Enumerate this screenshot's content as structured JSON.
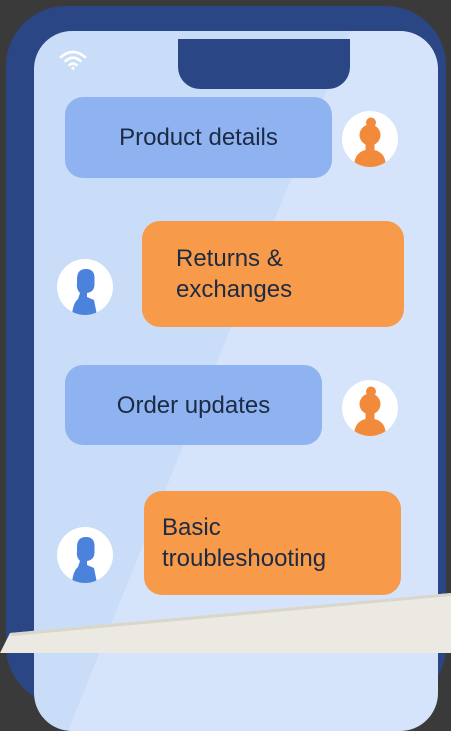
{
  "chat": {
    "messages": [
      {
        "text": "Product details",
        "side": "agent",
        "color": "#8fb3f0",
        "avatar": "woman-avatar"
      },
      {
        "text": "Returns &\nexchanges",
        "side": "customer",
        "color": "#f79a49",
        "avatar": "man-avatar"
      },
      {
        "text": "Order updates",
        "side": "agent",
        "color": "#8fb3f0",
        "avatar": "woman-avatar"
      },
      {
        "text": "Basic\ntroubleshooting",
        "side": "customer",
        "color": "#f79a49",
        "avatar": "man-avatar"
      }
    ]
  },
  "status_bar": {
    "icon": "wifi-icon"
  },
  "colors": {
    "frame": "#2b4684",
    "screen": "#c9dcf8",
    "agent_bubble": "#8fb3f0",
    "customer_bubble": "#f79a49",
    "background": "#3a3a3a",
    "paper": "#ebe9e1"
  }
}
